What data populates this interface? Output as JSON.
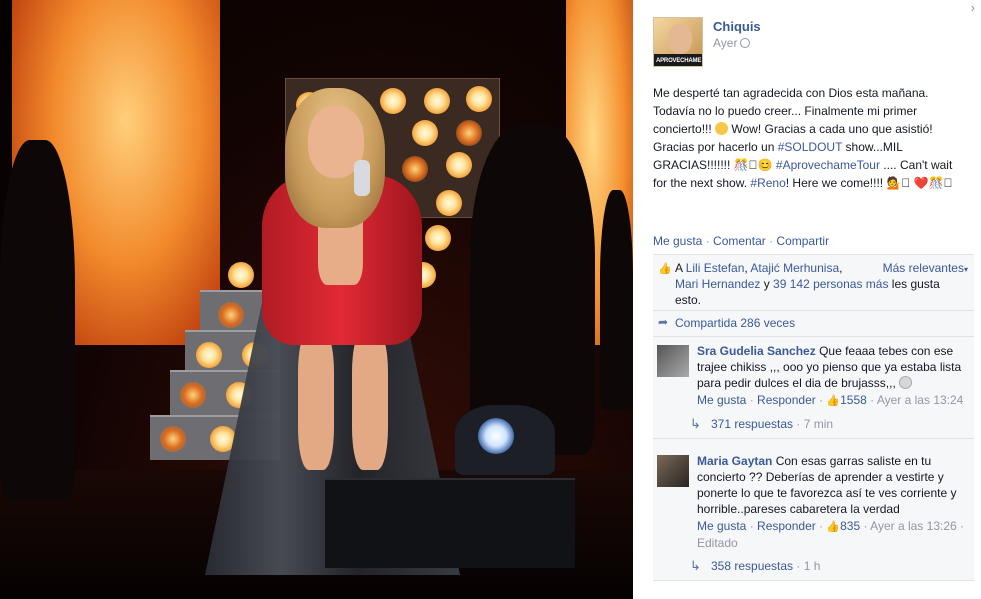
{
  "post": {
    "close_icon": "›",
    "author": "Chiquis",
    "timestamp": "Ayer",
    "visibility_icon": "globe-icon",
    "avatar_text": "APROVECHAME",
    "text_before_1": "Me desperté tan agradecida con Dios esta mañana. Todavía no lo puedo creer... Finalmente mi primer concierto!!! ",
    "text_before_2": " Wow! Gracias a cada uno que asistió! Gracias por hacerlo un ",
    "hashtag_soldout": "#SOLDOUT",
    "text_mid": " show...MIL GRACIAS!!!!!!! 🎊􏰀😊 ",
    "hashtag_tour": "#AprovechameTour",
    "text_after": " .... Can't wait for the next show. ",
    "hashtag_reno": "#Reno",
    "text_end": "! Here we come!!!! 💁􏰀 ❤️🎊􏰀",
    "actions": {
      "like": "Me gusta",
      "comment": "Comentar",
      "share": "Compartir",
      "separator": "·"
    }
  },
  "likes": {
    "prefix": "A ",
    "people": [
      "Lili Estefan",
      "Atajić Merhunisa",
      "Mari Hernandez"
    ],
    "conjunction": " y ",
    "others": "39 142 personas más",
    "suffix": " les gusta esto.",
    "sort_label": "Más relevantes",
    "sort_caret": "▾"
  },
  "shares": {
    "label": "Compartida 286 veces"
  },
  "comments": [
    {
      "name": "Sra Gudelia Sanchez",
      "text": "Que feaaa tebes con ese trajee chikiss ,,, ooo yo pienso que ya estaba lista para pedir dulces el dia de brujasss,,, ",
      "like_label": "Me gusta",
      "reply_label": "Responder",
      "likes": "1558",
      "time": "Ayer a las 13:24",
      "edited": "",
      "replies": "371 respuestas",
      "replies_age": "7 min"
    },
    {
      "name": "Maria Gaytan",
      "text": "Con esas garras saliste en tu concierto ?? Deberías de aprender a vestirte y ponerte lo que te favorezca así te ves corriente y horrible..pareses cabaretera la verdad",
      "like_label": "Me gusta",
      "reply_label": "Responder",
      "likes": "835",
      "time": "Ayer a las 13:26",
      "edited": "Editado",
      "replies": "358 respuestas",
      "replies_age": "1 h"
    }
  ],
  "colors": {
    "link": "#3b5998",
    "meta": "#9197a3",
    "ufi_bg": "#f6f7f9"
  }
}
